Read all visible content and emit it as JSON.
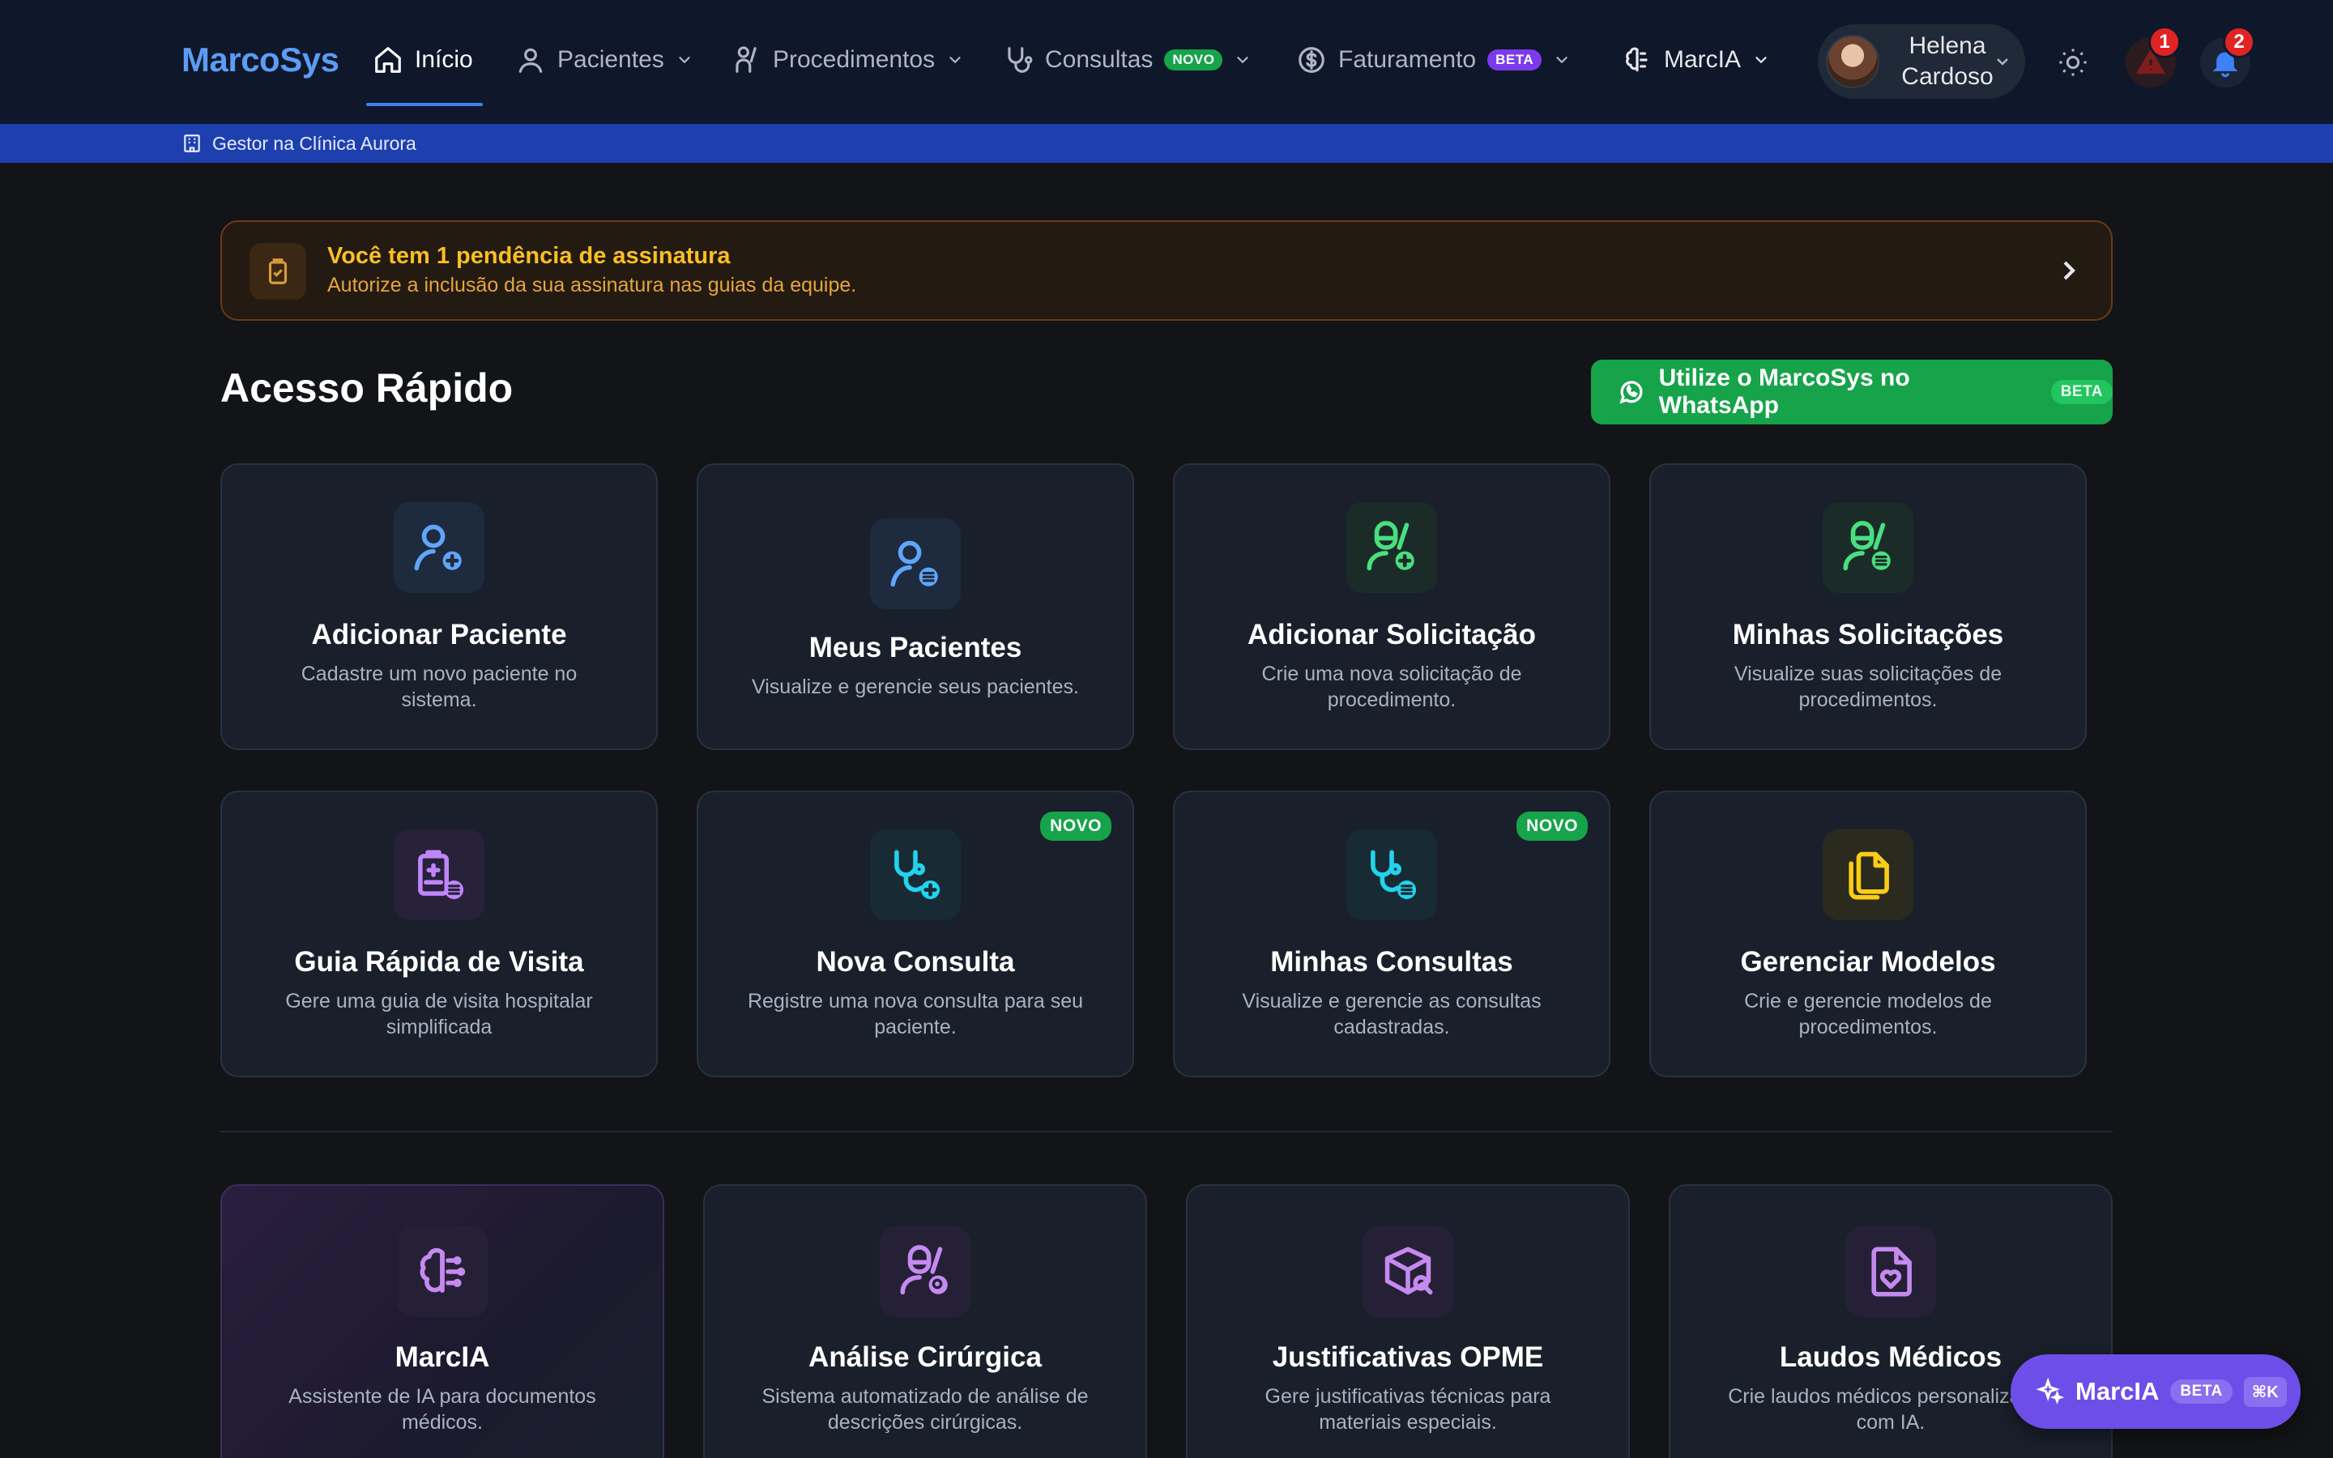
{
  "brand": "MarcoSys",
  "nav": {
    "inicio": "Início",
    "pacientes": "Pacientes",
    "procedimentos": "Procedimentos",
    "consultas": "Consultas",
    "consultas_badge": "NOVO",
    "faturamento": "Faturamento",
    "faturamento_badge": "BETA",
    "marcia": "MarcIA"
  },
  "user": {
    "first_name": "Helena",
    "last_name": "Cardoso"
  },
  "alerts": {
    "warning_count": "1",
    "notification_count": "2"
  },
  "subbar": {
    "text": "Gestor na Clínica Aurora"
  },
  "banner": {
    "title": "Você tem 1 pendência de assinatura",
    "subtitle": "Autorize a inclusão da sua assinatura nas guias da equipe."
  },
  "quick_access": {
    "title": "Acesso Rápido",
    "whatsapp_label": "Utilize o MarcoSys no WhatsApp",
    "whatsapp_badge": "BETA"
  },
  "cards": [
    {
      "title": "Adicionar Paciente",
      "desc": "Cadastre um novo paciente no sistema.",
      "icon": "user-plus-icon",
      "color": "#60a5fa"
    },
    {
      "title": "Meus Pacientes",
      "desc": "Visualize e gerencie seus pacientes.",
      "icon": "user-list-icon",
      "color": "#60a5fa"
    },
    {
      "title": "Adicionar Solicitação",
      "desc": "Crie uma nova solicitação de procedimento.",
      "icon": "surgeon-plus-icon",
      "color": "#4ade80"
    },
    {
      "title": "Minhas Solicitações",
      "desc": "Visualize suas solicitações de procedimentos.",
      "icon": "surgeon-list-icon",
      "color": "#4ade80"
    },
    {
      "title": "Guia Rápida de Visita",
      "desc": "Gere uma guia de visita hospitalar simplificada",
      "icon": "clipboard-list-icon",
      "color": "#c084fc"
    },
    {
      "title": "Nova Consulta",
      "desc": "Registre uma nova consulta para seu paciente.",
      "icon": "stethoscope-plus-icon",
      "color": "#22d3ee",
      "badge": "NOVO"
    },
    {
      "title": "Minhas Consultas",
      "desc": "Visualize e gerencie as consultas cadastradas.",
      "icon": "stethoscope-list-icon",
      "color": "#22d3ee",
      "badge": "NOVO"
    },
    {
      "title": "Gerenciar Modelos",
      "desc": "Crie e gerencie modelos de procedimentos.",
      "icon": "files-icon",
      "color": "#facc15"
    }
  ],
  "ai_cards": [
    {
      "title": "MarcIA",
      "desc": "Assistente de IA para documentos médicos.",
      "icon": "brain-icon"
    },
    {
      "title": "Análise Cirúrgica",
      "desc": "Sistema automatizado de análise de descrições cirúrgicas.",
      "icon": "surgeon-search-icon"
    },
    {
      "title": "Justificativas OPME",
      "desc": "Gere justificativas técnicas para materiais especiais.",
      "icon": "package-search-icon"
    },
    {
      "title": "Laudos Médicos",
      "desc": "Crie laudos médicos personalizados com IA.",
      "icon": "file-heart-icon"
    }
  ],
  "fab": {
    "label": "MarcIA",
    "badge": "BETA",
    "shortcut": "⌘K"
  }
}
